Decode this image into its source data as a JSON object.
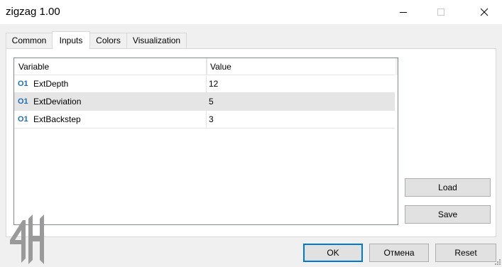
{
  "window": {
    "title": "zigzag 1.00",
    "controls": [
      "minimize-icon",
      "maximize-icon",
      "close-icon"
    ]
  },
  "tabs": [
    {
      "label": "Common",
      "active": false
    },
    {
      "label": "Inputs",
      "active": true
    },
    {
      "label": "Colors",
      "active": false
    },
    {
      "label": "Visualization",
      "active": false
    }
  ],
  "grid": {
    "headers": {
      "variable": "Variable",
      "value": "Value"
    },
    "type_badge": "O1",
    "rows": [
      {
        "variable": "ExtDepth",
        "value": "12",
        "selected": false
      },
      {
        "variable": "ExtDeviation",
        "value": "5",
        "selected": true
      },
      {
        "variable": "ExtBackstep",
        "value": "3",
        "selected": false
      }
    ]
  },
  "side_buttons": {
    "load": "Load",
    "save": "Save"
  },
  "footer_buttons": {
    "ok": "OK",
    "cancel": "Отмена",
    "reset": "Reset"
  },
  "colors": {
    "accent": "#0078d7",
    "badge": "#1e6fb5",
    "watermark": "#9a9a9a"
  }
}
